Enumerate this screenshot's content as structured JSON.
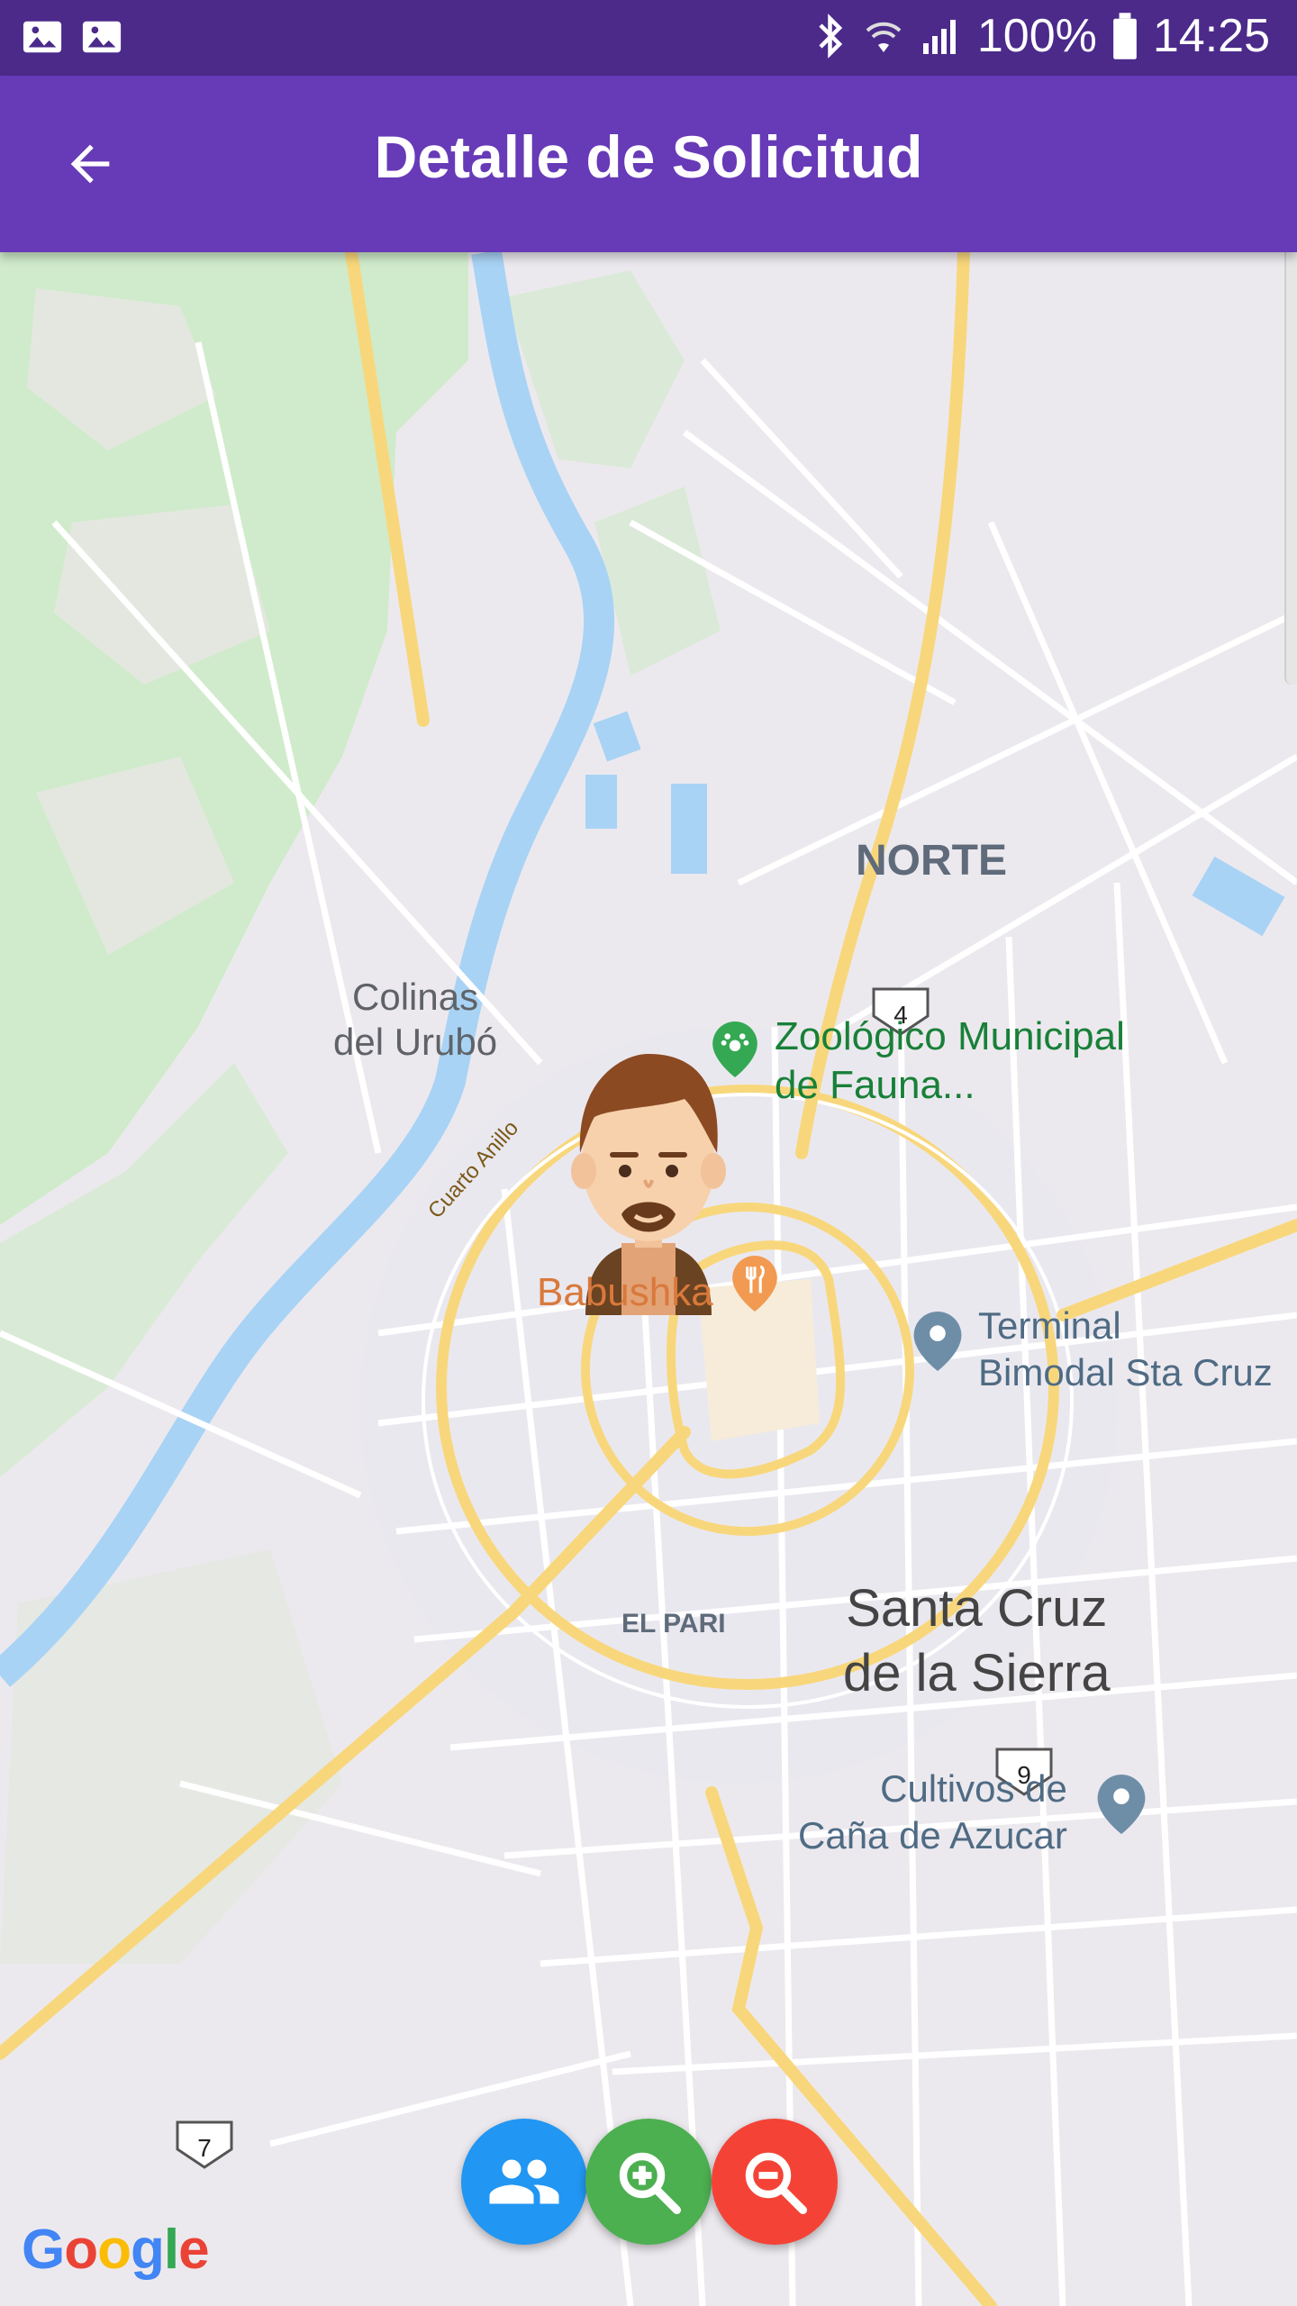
{
  "status_bar": {
    "left_icons": [
      "image-icon",
      "image-icon"
    ],
    "battery": "100%",
    "time": "14:25"
  },
  "app_bar": {
    "title": "Detalle de Solicitud",
    "back_icon": "arrow-back-icon"
  },
  "map": {
    "labels": {
      "norte": "NORTE",
      "colinas": "Colinas\ndel Urubó",
      "zoo": "Zoológico Municipal\nde Fauna...",
      "babushka": "Babushka",
      "terminal": "Terminal\nBimodal Sta Cruz",
      "santa_cruz": "Santa Cruz\nde la Sierra",
      "el_pari": "EL PARI",
      "cultivos": "Cultivos de\nCaña de Azucar",
      "cuarto_anillo": "Cuarto Anillo"
    },
    "route_shields": [
      "4",
      "9",
      "7"
    ],
    "attribution": "Google"
  },
  "actions": [
    {
      "name": "group",
      "icon": "group-icon",
      "color": "#2196f3"
    },
    {
      "name": "zoom-in",
      "icon": "zoom-in-icon",
      "color": "#4caf50"
    },
    {
      "name": "zoom-out",
      "icon": "zoom-out-icon",
      "color": "#f44336"
    }
  ],
  "colors": {
    "status_bar": "#4b2a8a",
    "app_bar": "#673ab7",
    "river": "#a8d3f5",
    "park": "#cdebc7",
    "highway": "#f8d77c"
  }
}
